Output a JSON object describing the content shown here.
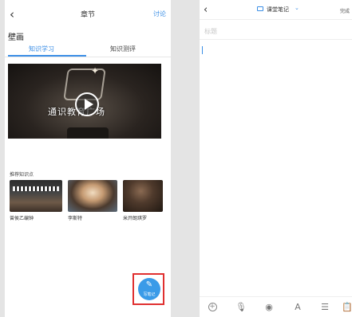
{
  "left_screen": {
    "header": {
      "title": "章节",
      "discuss_label": "讨论"
    },
    "course_title": "壁画",
    "tabs": [
      {
        "label": "知识学习"
      },
      {
        "label": "知识测评"
      }
    ],
    "video": {
      "caption": "通识教育广场"
    },
    "recommended": {
      "title": "推荐知识点",
      "items": [
        {
          "label": "曾侯乙编钟"
        },
        {
          "label": "李斯特"
        },
        {
          "label": "米开朗琪罗"
        }
      ]
    },
    "note_button": {
      "label": "写笔记"
    }
  },
  "right_screen": {
    "header": {
      "notebook_title": "课堂笔记",
      "done_label": "完成"
    },
    "title_input": {
      "placeholder": "标题",
      "value": ""
    },
    "body": {
      "value": ""
    },
    "toolbar": {
      "icons": [
        "add-icon",
        "microphone-icon",
        "camera-icon",
        "text-format-icon",
        "list-icon",
        "clipboard-icon"
      ],
      "format_glyph": "A"
    }
  },
  "colors": {
    "accent": "#3a8ee6",
    "highlight_frame": "#e03030",
    "note_button": "#3a9be8"
  }
}
